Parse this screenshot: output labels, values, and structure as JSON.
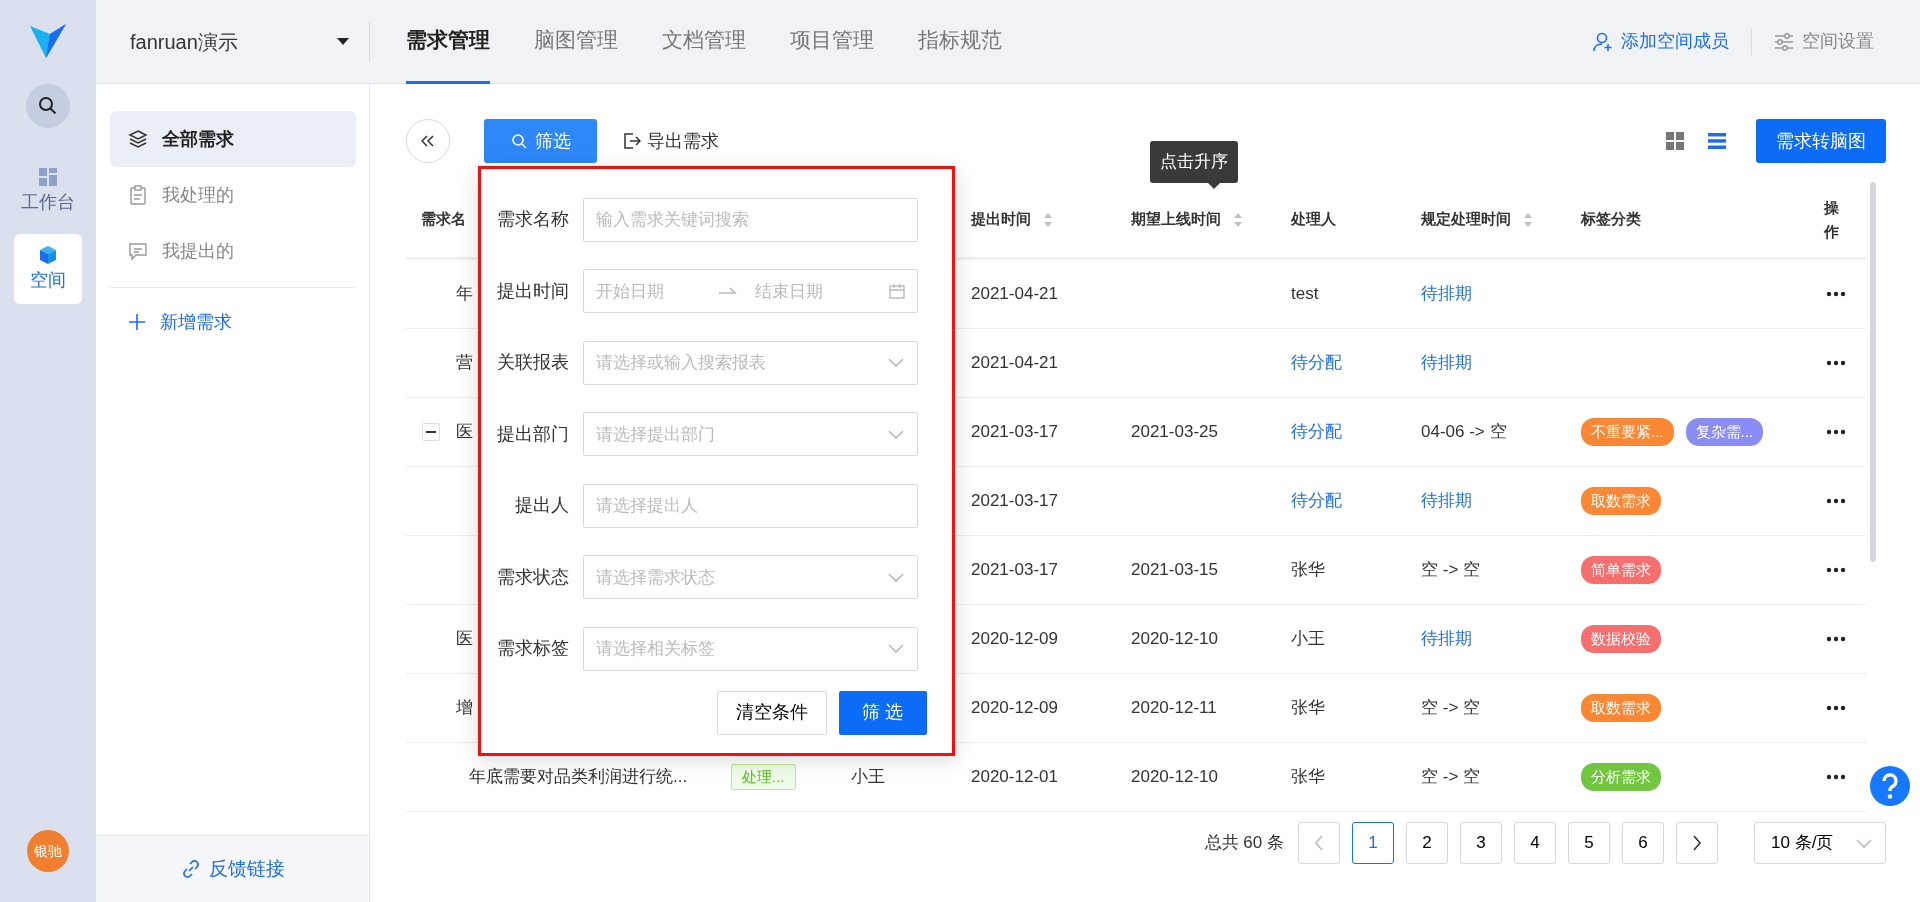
{
  "rail": {
    "items": [
      {
        "kind": "workbench",
        "label": "工作台",
        "selected": false
      },
      {
        "kind": "space",
        "label": "空间",
        "selected": true
      }
    ],
    "avatar": "银驰"
  },
  "space_selector": "fanruan演示",
  "tabs": [
    {
      "label": "需求管理",
      "selected": true
    },
    {
      "label": "脑图管理",
      "selected": false
    },
    {
      "label": "文档管理",
      "selected": false
    },
    {
      "label": "项目管理",
      "selected": false
    },
    {
      "label": "指标规范",
      "selected": false
    }
  ],
  "header_actions": [
    {
      "kind": "add-member",
      "label": "添加空间成员"
    },
    {
      "kind": "settings",
      "label": "空间设置"
    }
  ],
  "sidebar": {
    "items": [
      {
        "kind": "layers",
        "label": "全部需求",
        "selected": true
      },
      {
        "kind": "clipboard",
        "label": "我处理的",
        "selected": false
      },
      {
        "kind": "comment",
        "label": "我提出的",
        "selected": false
      }
    ],
    "add": "新增需求",
    "footer": "反馈链接"
  },
  "toolbar": {
    "filter": "筛选",
    "export": "导出需求",
    "views": [
      {
        "kind": "grid",
        "selected": false
      },
      {
        "kind": "list",
        "selected": true
      }
    ],
    "convert": "需求转脑图"
  },
  "tooltip": "点击升序",
  "table": {
    "columns": [
      {
        "label": "需求名"
      },
      {
        "label": "提出时间",
        "sortable": true
      },
      {
        "label": "期望上线时间",
        "sortable": true
      },
      {
        "label": "处理人"
      },
      {
        "label": "规定处理时间",
        "sortable": true
      },
      {
        "label": "标签分类"
      },
      {
        "label": "操作"
      }
    ],
    "rows": [
      {
        "name": "年",
        "submit_date": "2021-04-21",
        "handler": {
          "text": "test",
          "link": false
        },
        "deadline": {
          "text": "待排期",
          "link": true
        }
      },
      {
        "name": "营",
        "submit_date": "2021-04-21",
        "handler": {
          "text": "待分配",
          "link": true
        },
        "deadline": {
          "text": "待排期",
          "link": true
        }
      },
      {
        "expanded": true,
        "name": "医",
        "submit_date": "2021-03-17",
        "expect_date": "2021-03-25",
        "handler": {
          "text": "待分配",
          "link": true
        },
        "deadline": {
          "text": "04-06 -> 空",
          "link": false
        },
        "tags": [
          {
            "label": "不重要紧...",
            "color": "#fa8733"
          },
          {
            "label": "复杂需...",
            "color": "#8c8cf5"
          }
        ]
      },
      {
        "submit_date": "2021-03-17",
        "handler": {
          "text": "待分配",
          "link": true
        },
        "deadline": {
          "text": "待排期",
          "link": true
        },
        "tags": [
          {
            "label": "取数需求",
            "color": "#fa8733"
          }
        ]
      },
      {
        "submit_date": "2021-03-17",
        "expect_date": "2021-03-15",
        "handler": {
          "text": "张华",
          "link": false
        },
        "deadline": {
          "text": "空 -> 空",
          "link": false
        },
        "tags": [
          {
            "label": "简单需求",
            "color": "#f66e6e"
          }
        ]
      },
      {
        "name": "医",
        "submit_date": "2020-12-09",
        "expect_date": "2020-12-10",
        "handler": {
          "text": "小王",
          "link": false
        },
        "deadline": {
          "text": "待排期",
          "link": true
        },
        "tags": [
          {
            "label": "数据校验",
            "color": "#f66e6e"
          }
        ]
      },
      {
        "name": "增",
        "submit_date": "2020-12-09",
        "expect_date": "2020-12-11",
        "handler": {
          "text": "张华",
          "link": false
        },
        "deadline": {
          "text": "空 -> 空",
          "link": false
        },
        "tags": [
          {
            "label": "取数需求",
            "color": "#fa8733"
          }
        ]
      },
      {
        "name": "年底需要对品类利润进行统...",
        "status": "处理...",
        "submitter": "小王",
        "submit_date": "2020-12-01",
        "expect_date": "2020-12-10",
        "handler": {
          "text": "张华",
          "link": false
        },
        "deadline": {
          "text": "空 -> 空",
          "link": false
        },
        "tags": [
          {
            "label": "分析需求",
            "color": "#71c63f"
          }
        ]
      }
    ]
  },
  "pagination": {
    "total": "总共 60 条",
    "pages": [
      {
        "label": "1",
        "selected": true
      },
      {
        "label": "2",
        "selected": false
      },
      {
        "label": "3",
        "selected": false
      },
      {
        "label": "4",
        "selected": false
      },
      {
        "label": "5",
        "selected": false
      },
      {
        "label": "6",
        "selected": false
      }
    ],
    "page_size": "10 条/页"
  },
  "filter_panel": {
    "fields": [
      {
        "kind": "text",
        "label": "需求名称",
        "placeholder": "输入需求关键词搜索"
      },
      {
        "kind": "daterange",
        "label": "提出时间",
        "placeholder_start": "开始日期",
        "placeholder_end": "结束日期"
      },
      {
        "kind": "select",
        "label": "关联报表",
        "placeholder": "请选择或输入搜索报表"
      },
      {
        "kind": "select",
        "label": "提出部门",
        "placeholder": "请选择提出部门"
      },
      {
        "kind": "text",
        "label": "提出人",
        "placeholder": "请选择提出人"
      },
      {
        "kind": "select",
        "label": "需求状态",
        "placeholder": "请选择需求状态"
      },
      {
        "kind": "select",
        "label": "需求标签",
        "placeholder": "请选择相关标签"
      }
    ],
    "clear": "清空条件",
    "submit": "筛 选"
  }
}
